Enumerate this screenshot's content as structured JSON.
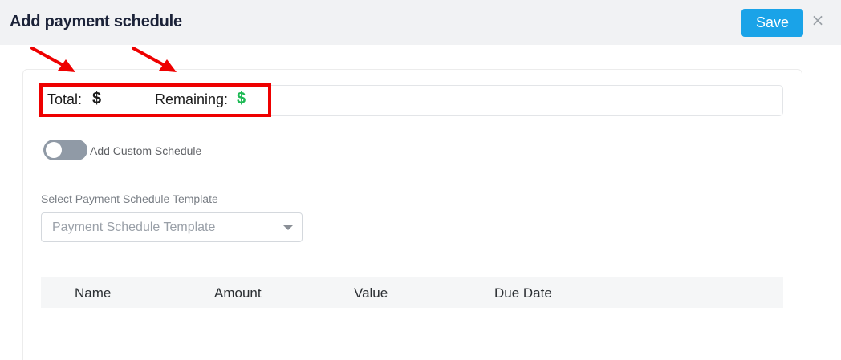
{
  "dialog": {
    "title": "Add payment schedule",
    "save_label": "Save",
    "close_glyph": "×"
  },
  "summary": {
    "total_label": "Total:",
    "total_value": "$",
    "remaining_label": "Remaining:",
    "remaining_value": "$"
  },
  "custom_schedule": {
    "label": "Add Custom Schedule",
    "enabled": false
  },
  "template_select": {
    "label": "Select Payment Schedule Template",
    "placeholder": "Payment Schedule Template"
  },
  "table": {
    "columns": [
      "Name",
      "Amount",
      "Value",
      "Due Date"
    ]
  },
  "colors": {
    "accent": "#1aa3e8",
    "remaining_dollar": "#1db954",
    "highlight_annotation": "#ee0000"
  },
  "icons": {
    "close": "close-icon",
    "caret": "chevron-down-icon",
    "annotation_arrow": "arrow-annotation-icon"
  }
}
